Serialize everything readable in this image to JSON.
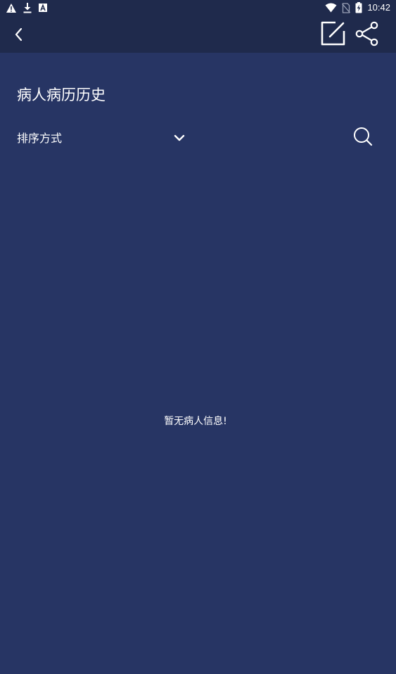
{
  "status_bar": {
    "time": "10:42",
    "left_icons": [
      "warning-icon",
      "download-icon",
      "font-icon"
    ],
    "right_icons": [
      "wifi-icon",
      "no-sim-icon",
      "battery-charging-icon"
    ]
  },
  "app_bar": {
    "back_icon": "back-arrow-icon",
    "edit_icon": "edit-icon",
    "share_icon": "share-icon"
  },
  "page": {
    "title": "病人病历历史"
  },
  "sort": {
    "label": "排序方式",
    "dropdown_icon": "chevron-down-icon",
    "search_icon": "search-icon"
  },
  "empty_state": {
    "message": "暂无病人信息!"
  },
  "colors": {
    "background": "#273564",
    "toolbar": "#1f2a4c",
    "text": "#ffffff"
  }
}
